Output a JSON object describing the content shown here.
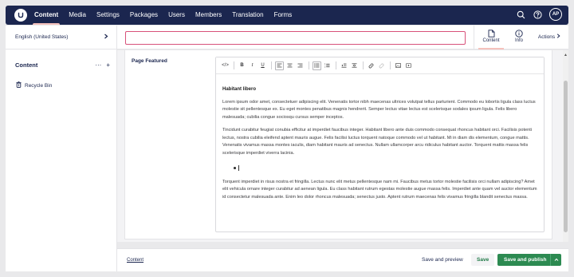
{
  "topbar": {
    "nav": [
      "Content",
      "Media",
      "Settings",
      "Packages",
      "Users",
      "Members",
      "Translation",
      "Forms"
    ],
    "active_nav": "Content",
    "avatar_initials": "AP"
  },
  "sidebar": {
    "language": "English (United States)",
    "section_title": "Content",
    "more_label": "···",
    "add_label": "+",
    "recycle_bin": "Recycle Bin"
  },
  "header": {
    "name_value": "",
    "views": [
      "Content",
      "Info"
    ],
    "actions_label": "Actions"
  },
  "property": {
    "label": "Page Featured"
  },
  "editor": {
    "toolbar_icons": [
      "source-code-icon",
      "bold-icon",
      "italic-icon",
      "underline-icon",
      "align-left-icon",
      "align-center-icon",
      "align-right-icon",
      "bullet-list-icon",
      "numbered-list-icon",
      "outdent-icon",
      "indent-icon",
      "link-icon",
      "unlink-icon",
      "image-icon",
      "embed-icon"
    ],
    "toolbar_text": {
      "source": "</>",
      "bold": "B",
      "italic": "I",
      "underline": "U"
    },
    "title": "Habitant libero",
    "para1": "Lorem ipsum odor amet, consectetuer adipiscing elit. Venenatis tortor nibh maecenas ultrices volutpat tellus parturient. Commodo eu lobortis ligula class luctus molestie sit pellentesque ex. Eu eget montes penatibus magnis hendrerit. Semper lectus vitae lectus est scelerisque sodales ipsum ligula. Felis libero malesuada; cubilia congue sociosqu cursus semper inceptos.",
    "para2": "Tincidunt curabitur feugiat conubia efficitur at imperdiet faucibus integer. Habitant libero ante duis commodo consequat rhoncus habitant orci. Facilisis potenti lectus, nostra cubilia eleifend aptent mauris augue. Felis facilisi luctus torquent natoque commodo vel ut habitant. Mi in diam dis elementum, congue mattis. Venenatis vivamus massa montes iaculis, diam habitant mauris ad senectus. Nullam ullamcorper arcu ridiculus habitant auctor. Torquent mattis massa felis scelerisque imperdiet viverra lacinia.",
    "para3": "Torquent imperdiet in risus nostra et fringilla. Lectus nunc elit metus pellentesque nam mi. Faucibus metus tortor molestie facilisis orci nullam adipiscing? Amet elit vehicula ornare integer curabitur ad aenean ligula. Eu class habitant rutrum egestas molestie augue massa felis. Imperdiet ante quam vel auctor elementum id consectetur malesuada ante. Enim leo dolor rhoncus malesuada; senectus justo. Aptent rutrum maecenas felis vivamus fringilla blandit senectus massa."
  },
  "footer": {
    "breadcrumb": "Content",
    "save_preview": "Save and preview",
    "save": "Save",
    "save_publish": "Save and publish"
  },
  "colors": {
    "topbar": "#1b264f",
    "active_underline": "#f5c1bc",
    "invalid_border": "#d8527a",
    "publish_green": "#2c8a51",
    "save_green": "#1f7a46"
  }
}
